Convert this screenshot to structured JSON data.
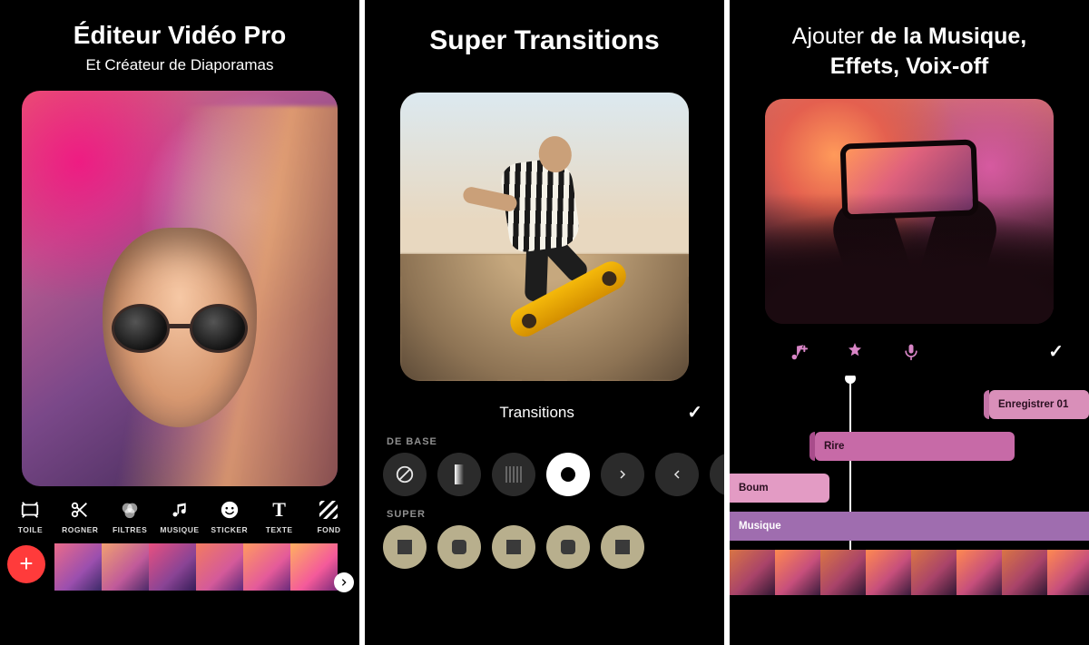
{
  "panel1": {
    "title": "Éditeur Vidéo Pro",
    "subtitle": "Et Créateur de Diaporamas",
    "tools": [
      {
        "icon": "canvas",
        "label": "TOILE"
      },
      {
        "icon": "scissors",
        "label": "ROGNER"
      },
      {
        "icon": "filters",
        "label": "FILTRES"
      },
      {
        "icon": "music",
        "label": "MUSIQUE"
      },
      {
        "icon": "sticker",
        "label": "STICKER"
      },
      {
        "icon": "text",
        "label": "TEXTE"
      },
      {
        "icon": "bg",
        "label": "FOND"
      }
    ],
    "add_label": "+"
  },
  "panel2": {
    "title": "Super Transitions",
    "section_title": "Transitions",
    "group_basic": "DE BASE",
    "group_super": "SUPER",
    "confirm_symbol": "✓",
    "basic_items": [
      {
        "icon": "none"
      },
      {
        "icon": "fade-v"
      },
      {
        "icon": "fade-h"
      },
      {
        "icon": "dot",
        "selected": true
      },
      {
        "icon": "chev-r"
      },
      {
        "icon": "chev-l"
      },
      {
        "icon": "chev-d"
      }
    ],
    "super_items": [
      {
        "icon": "sq"
      },
      {
        "icon": "sq-r"
      },
      {
        "icon": "sq"
      },
      {
        "icon": "sq-r"
      },
      {
        "icon": "sq"
      }
    ]
  },
  "panel3": {
    "title_light": "Ajouter ",
    "title_bold1": "de la Musique,",
    "title_bold2": "Effets, Voix-off",
    "confirm_symbol": "✓",
    "tracks": {
      "record": "Enregistrer 01",
      "rire": "Rire",
      "boum": "Boum",
      "musique": "Musique"
    }
  }
}
